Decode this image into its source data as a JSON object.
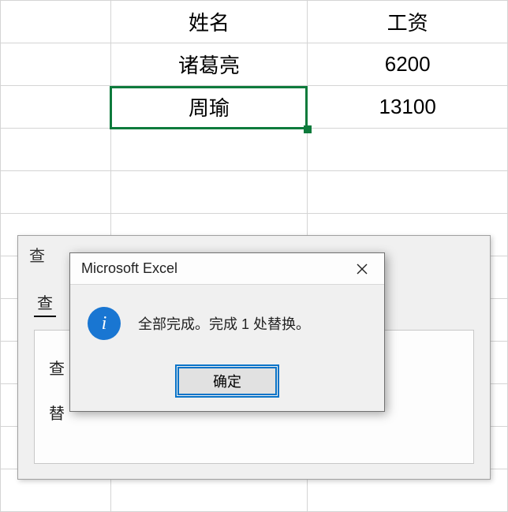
{
  "spreadsheet": {
    "headers": {
      "name": "姓名",
      "salary": "工资"
    },
    "rows": [
      {
        "name": "诸葛亮",
        "salary": "6200"
      },
      {
        "name": "周瑜",
        "salary": "13100"
      }
    ]
  },
  "find_dialog": {
    "title_partial": "查",
    "tab_find_partial": "查",
    "field_find_partial": "查",
    "field_replace_partial": "替"
  },
  "msgbox": {
    "title": "Microsoft Excel",
    "icon_glyph": "i",
    "message": "全部完成。完成 1 处替换。",
    "ok_label": "确定"
  }
}
